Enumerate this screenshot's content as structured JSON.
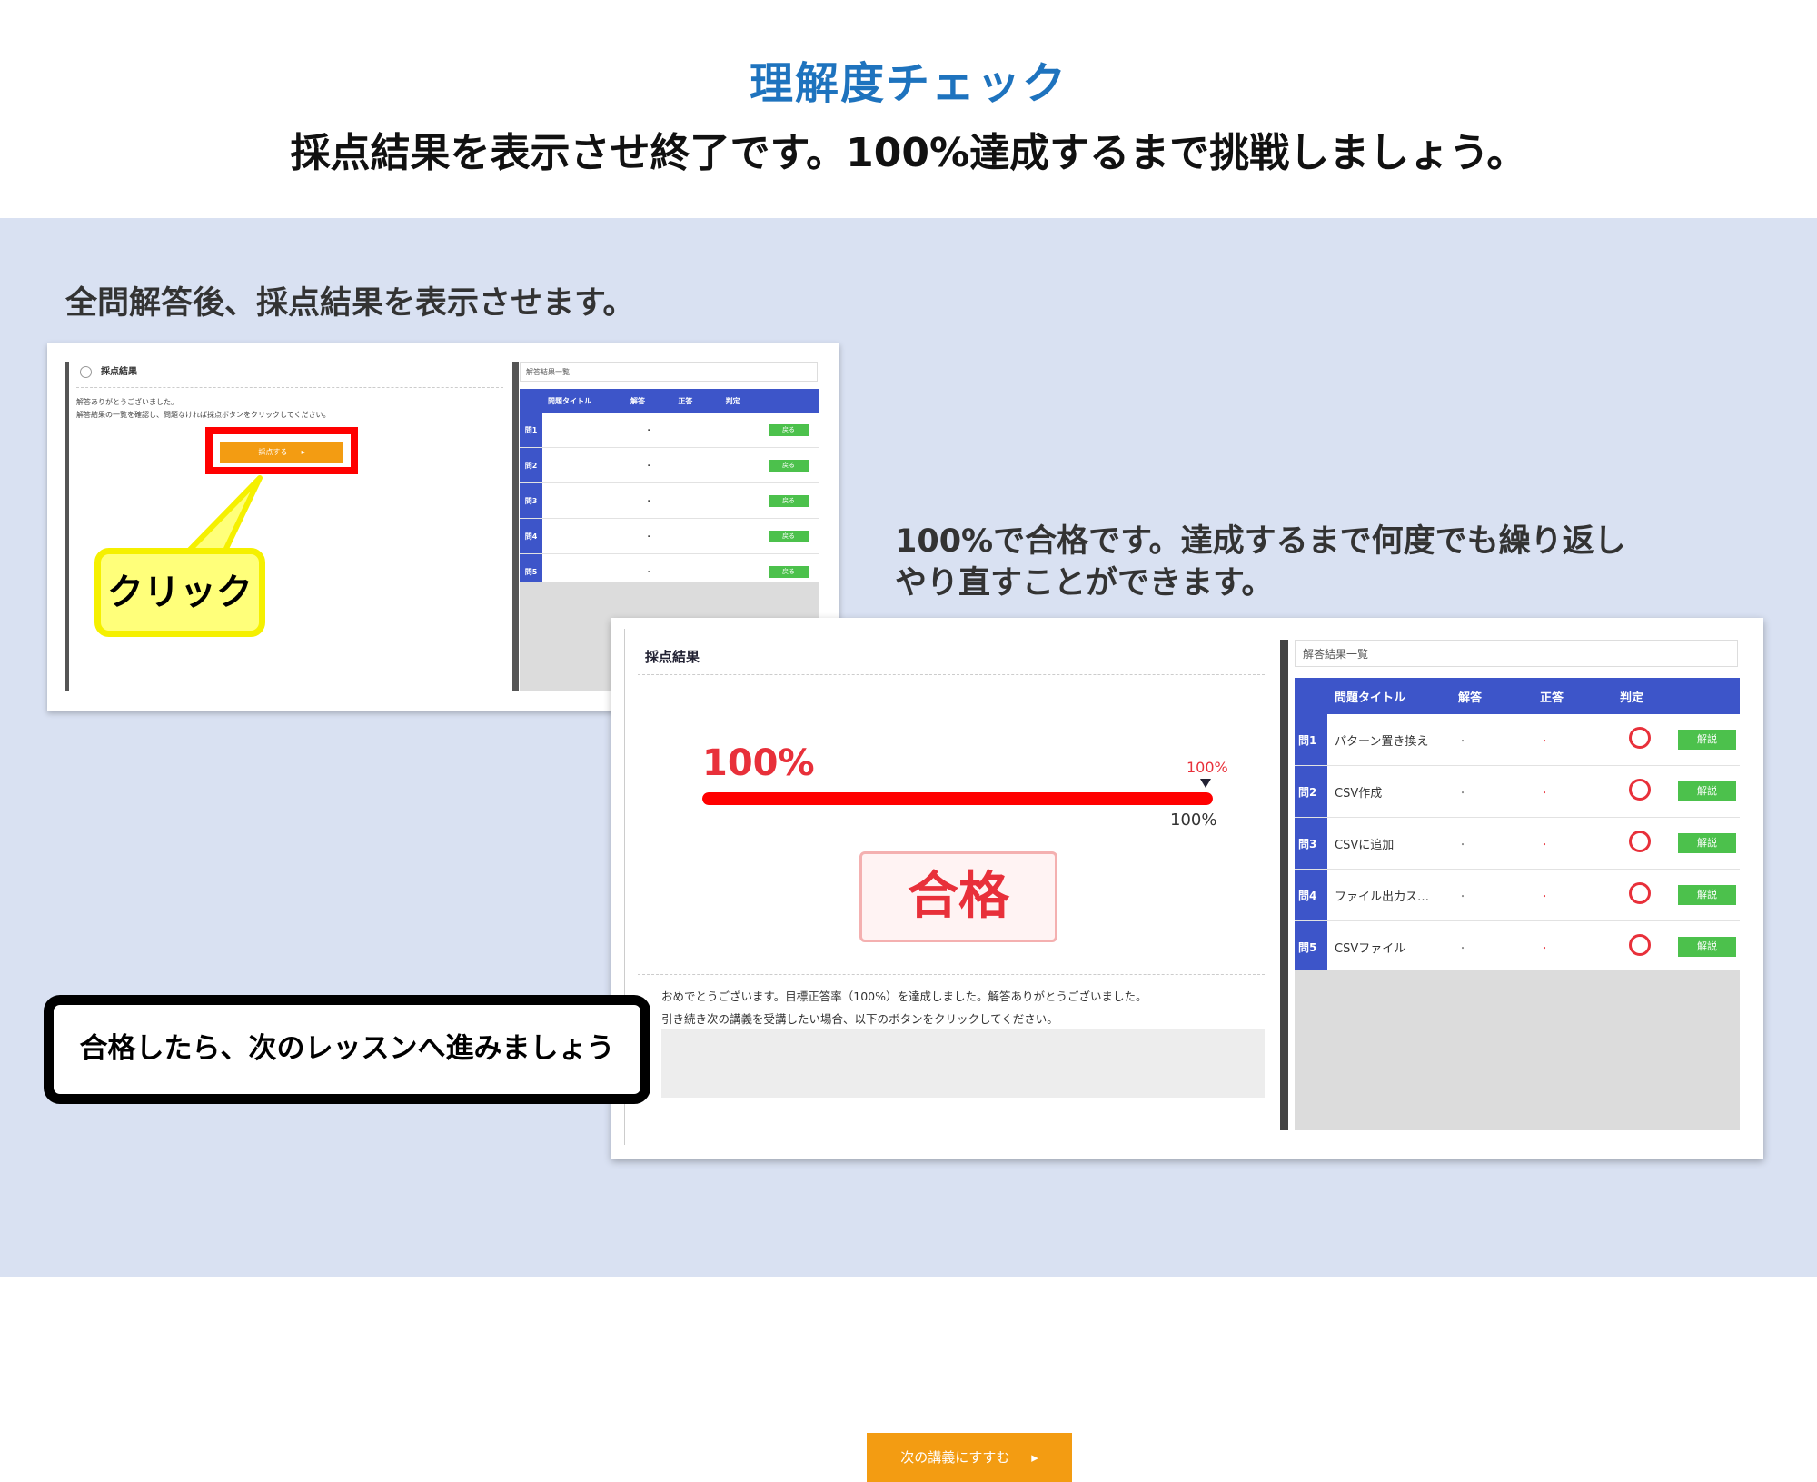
{
  "slide": {
    "title": "理解度チェック",
    "subtitle": "採点結果を表示させ終了です。100%達成するまで挑戦しましょう。",
    "caption1": "全問解答後、採点結果を表示させます。",
    "caption2_line1": "100%で合格です。達成するまで何度でも繰り返し",
    "caption2_line2": "やり直すことができます。",
    "callout": "クリック",
    "pass_note": "合格したら、次のレッスンへ進みましょう"
  },
  "shot1": {
    "panel_title": "採点結果",
    "message_line1": "解答ありがとうございました。",
    "message_line2": "解答結果の一覧を確認し、問題なければ採点ボタンをクリックしてください。",
    "score_button": "採点する",
    "list_title": "解答結果一覧",
    "columns": [
      "問題タイトル",
      "解答",
      "正答",
      "判定"
    ],
    "rows": [
      {
        "q": "問1",
        "answer": "・",
        "button": "戻る"
      },
      {
        "q": "問2",
        "answer": "・",
        "button": "戻る"
      },
      {
        "q": "問3",
        "answer": "・",
        "button": "戻る"
      },
      {
        "q": "問4",
        "answer": "・",
        "button": "戻る"
      },
      {
        "q": "問5",
        "answer": "・",
        "button": "戻る"
      }
    ]
  },
  "shot2": {
    "panel_title": "採点結果",
    "score_percent_text": "100%",
    "target_label": "100%",
    "score_under_label": "100%",
    "score_fraction": 1.0,
    "result_label": "合格",
    "message_line1": "おめでとうございます。目標正答率（100%）を達成しました。解答ありがとうございました。",
    "message_line2": "引き続き次の講義を受講したい場合、以下のボタンをクリックしてください。",
    "next_button": "次の講義にすすむ",
    "list_title": "解答結果一覧",
    "columns": [
      "問題タイトル",
      "解答",
      "正答",
      "判定"
    ],
    "rows": [
      {
        "q": "問1",
        "title": "パターン置き換え",
        "answer": "・",
        "correct": "・",
        "button": "解説"
      },
      {
        "q": "問2",
        "title": "CSV作成",
        "answer": "・",
        "correct": "・",
        "button": "解説"
      },
      {
        "q": "問3",
        "title": "CSVに追加",
        "answer": "・",
        "correct": "・",
        "button": "解説"
      },
      {
        "q": "問4",
        "title": "ファイル出力ス…",
        "answer": "・",
        "correct": "・",
        "button": "解説"
      },
      {
        "q": "問5",
        "title": "CSVファイル",
        "answer": "・",
        "correct": "・",
        "button": "解説"
      }
    ]
  },
  "colors": {
    "title_blue": "#1e73be",
    "band": "#d9e1f2",
    "table_header": "#3d55c9",
    "orange": "#f39c12",
    "red": "#e8303a",
    "green": "#4cc14c",
    "callout_yellow": "#ffff7a"
  }
}
